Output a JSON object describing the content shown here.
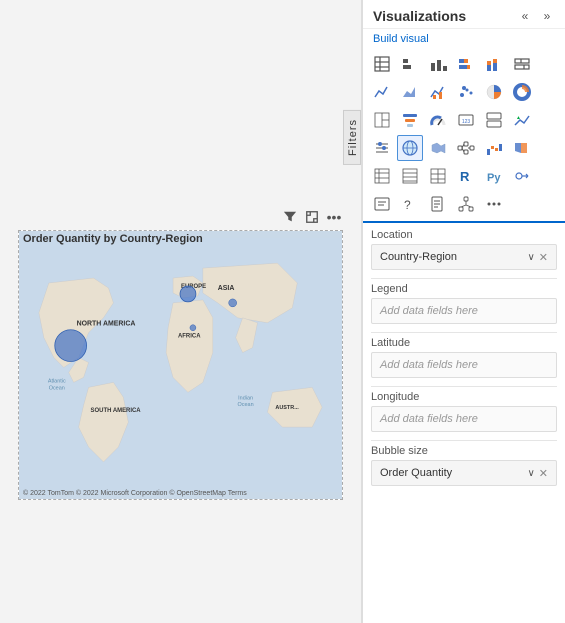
{
  "canvas": {
    "background": "#f3f3f3",
    "filters_tab": "Filters"
  },
  "visual": {
    "title": "Order Quantity by Country-Region",
    "toolbar": {
      "filter_icon": "⊞",
      "expand_icon": "⤢",
      "more_icon": "…"
    },
    "map_footer": "© 2022 TomTom © 2022 Microsoft Corporation © OpenStreetMap Terms"
  },
  "viz_panel": {
    "title": "Visualizations",
    "collapse_icon": "«",
    "expand_icon": "»",
    "build_visual_label": "Build visual",
    "icons": {
      "rows": [
        [
          "table",
          "clustered-bar",
          "clustered-column",
          "stacked-bar",
          "stacked-column",
          "100-stacked-bar"
        ],
        [
          "line",
          "area",
          "line-cluster",
          "scatter",
          "pie",
          "donut"
        ],
        [
          "treemap",
          "funnel",
          "gauge",
          "card",
          "multi-row-card",
          "kpi"
        ],
        [
          "slicer",
          "map",
          "filled-map",
          "decomp-tree",
          "waterfall",
          "ribbon"
        ],
        [
          "matrix",
          "table2",
          "table3",
          "r-visual",
          "python",
          "key-influencers"
        ],
        [
          "smart-narrative",
          "qa",
          "paginated",
          "decomp2",
          "more-visuals",
          "custom"
        ]
      ],
      "active_index": [
        3,
        0
      ]
    }
  },
  "field_wells": {
    "location": {
      "label": "Location",
      "value": "Country-Region",
      "has_chevron": true,
      "has_close": true
    },
    "legend": {
      "label": "Legend",
      "placeholder": "Add data fields here"
    },
    "latitude": {
      "label": "Latitude",
      "placeholder": "Add data fields here"
    },
    "longitude": {
      "label": "Longitude",
      "placeholder": "Add data fields here"
    },
    "bubble_size": {
      "label": "Bubble size",
      "value": "Order Quantity",
      "has_chevron": true,
      "has_close": true
    }
  }
}
